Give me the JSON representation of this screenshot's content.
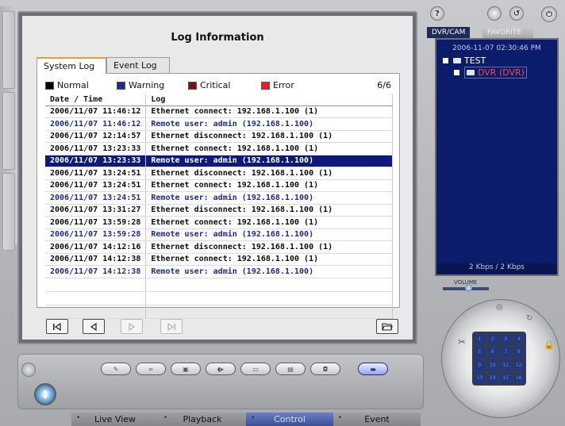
{
  "title": "Log Information",
  "tabs": [
    {
      "label": "System Log",
      "active": true
    },
    {
      "label": "Event Log",
      "active": false
    }
  ],
  "legend": [
    {
      "label": "Normal",
      "color": "#000000"
    },
    {
      "label": "Warning",
      "color": "#1d2b8a"
    },
    {
      "label": "Critical",
      "color": "#7a1010"
    },
    {
      "label": "Error",
      "color": "#ee1b1b"
    }
  ],
  "page_count": "6/6",
  "columns": [
    "Date / Time",
    "Log"
  ],
  "rows": [
    {
      "datetime": "2006/11/07 11:46:12",
      "log": "Ethernet connect: 192.168.1.100 (1)",
      "level": "normal"
    },
    {
      "datetime": "2006/11/07 11:46:12",
      "log": "Remote user: admin (192.168.1.100)",
      "level": "warning"
    },
    {
      "datetime": "2006/11/07 12:14:57",
      "log": "Ethernet disconnect: 192.168.1.100 (1)",
      "level": "normal"
    },
    {
      "datetime": "2006/11/07 13:23:33",
      "log": "Ethernet connect: 192.168.1.100 (1)",
      "level": "normal"
    },
    {
      "datetime": "2006/11/07 13:23:33",
      "log": "Remote user: admin (192.168.1.100)",
      "level": "selected"
    },
    {
      "datetime": "2006/11/07 13:24:51",
      "log": "Ethernet disconnect: 192.168.1.100 (1)",
      "level": "normal"
    },
    {
      "datetime": "2006/11/07 13:24:51",
      "log": "Ethernet connect: 192.168.1.100 (1)",
      "level": "normal"
    },
    {
      "datetime": "2006/11/07 13:24:51",
      "log": "Remote user: admin (192.168.1.100)",
      "level": "warning"
    },
    {
      "datetime": "2006/11/07 13:31:27",
      "log": "Ethernet disconnect: 192.168.1.100 (1)",
      "level": "normal"
    },
    {
      "datetime": "2006/11/07 13:59:28",
      "log": "Ethernet connect: 192.168.1.100 (1)",
      "level": "normal"
    },
    {
      "datetime": "2006/11/07 13:59:28",
      "log": "Remote user: admin (192.168.1.100)",
      "level": "warning"
    },
    {
      "datetime": "2006/11/07 14:12:16",
      "log": "Ethernet disconnect: 192.168.1.100 (1)",
      "level": "normal"
    },
    {
      "datetime": "2006/11/07 14:12:38",
      "log": "Ethernet connect: 192.168.1.100 (1)",
      "level": "normal"
    },
    {
      "datetime": "2006/11/07 14:12:38",
      "log": "Remote user: admin (192.168.1.100)",
      "level": "warning"
    }
  ],
  "empty_rows": 3,
  "navigation": {
    "first": "⏮",
    "prev": "◁",
    "next": "▷",
    "last": "⏭"
  },
  "right_panel": {
    "tabs": [
      {
        "label": "DVR/CAM",
        "active": true
      },
      {
        "label": "FAVORITE",
        "active": false
      }
    ],
    "timestamp": "2006-11-07 02:30:46 PM",
    "tree_root": "TEST",
    "tree_child": "DVR (DVR)",
    "rate": "2 Kbps / 2 Kbps",
    "volume_label": "VOLUME",
    "volume_level": 0.55,
    "grid_cells": [
      "1",
      "2",
      "3",
      "4",
      "5",
      "6",
      "7",
      "8",
      "9",
      "10",
      "11",
      "12",
      "13",
      "14",
      "15",
      "16"
    ]
  },
  "bottom_nav": [
    {
      "label": "Live View",
      "active": false
    },
    {
      "label": "Playback",
      "active": false
    },
    {
      "label": "Control",
      "active": true
    },
    {
      "label": "Event",
      "active": false
    }
  ]
}
